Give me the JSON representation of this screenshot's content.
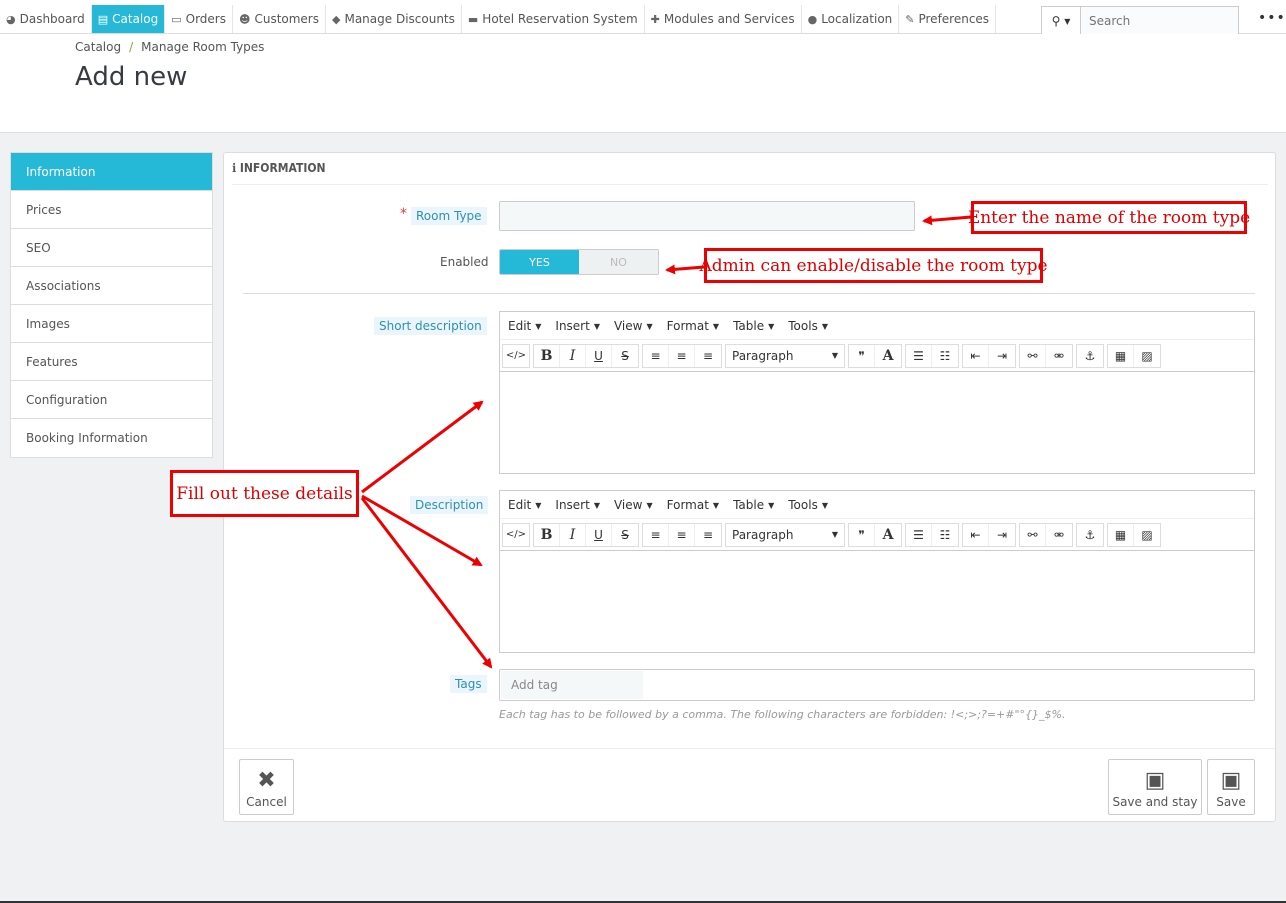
{
  "nav": {
    "items": [
      {
        "icon": "dashboard-icon",
        "glyph": "◕",
        "label": "Dashboard"
      },
      {
        "icon": "book-icon",
        "glyph": "▤",
        "label": "Catalog",
        "active": true
      },
      {
        "icon": "credit-card-icon",
        "glyph": "▭",
        "label": "Orders"
      },
      {
        "icon": "users-icon",
        "glyph": "☻",
        "label": "Customers"
      },
      {
        "icon": "tags-icon",
        "glyph": "◆",
        "label": "Manage Discounts"
      },
      {
        "icon": "bed-icon",
        "glyph": "▬",
        "label": "Hotel Reservation System"
      },
      {
        "icon": "puzzle-icon",
        "glyph": "✚",
        "label": "Modules and Services"
      },
      {
        "icon": "globe-icon",
        "glyph": "●",
        "label": "Localization"
      },
      {
        "icon": "wrench-icon",
        "glyph": "✎",
        "label": "Preferences"
      }
    ],
    "search_placeholder": "Search"
  },
  "header": {
    "breadcrumb": [
      "Catalog",
      "Manage Room Types"
    ],
    "title": "Add new"
  },
  "tabs": [
    "Information",
    "Prices",
    "SEO",
    "Associations",
    "Images",
    "Features",
    "Configuration",
    "Booking Information"
  ],
  "panel": {
    "heading": "INFORMATION",
    "room_type_label": "Room Type",
    "required_mark": "*",
    "enabled_label": "Enabled",
    "switch_yes": "YES",
    "switch_no": "NO",
    "short_description_label": "Short description",
    "description_label": "Description",
    "editor_menus": [
      "Edit",
      "Insert",
      "View",
      "Format",
      "Table",
      "Tools"
    ],
    "format_select": "Paragraph",
    "tags_label": "Tags",
    "tags_placeholder": "Add tag",
    "tags_help": "Each tag has to be followed by a comma. The following characters are forbidden: !<;>;?=+#\"°{}_$%."
  },
  "footer": {
    "cancel": "Cancel",
    "save_and_stay": "Save and stay",
    "save": "Save"
  },
  "annotations": {
    "room_type": "Enter the name of the room type",
    "enabled": "Admin can enable/disable the room type",
    "details": "Fill out these details"
  },
  "colors": {
    "accent": "#25b9d7",
    "annotation": "#e00000"
  }
}
